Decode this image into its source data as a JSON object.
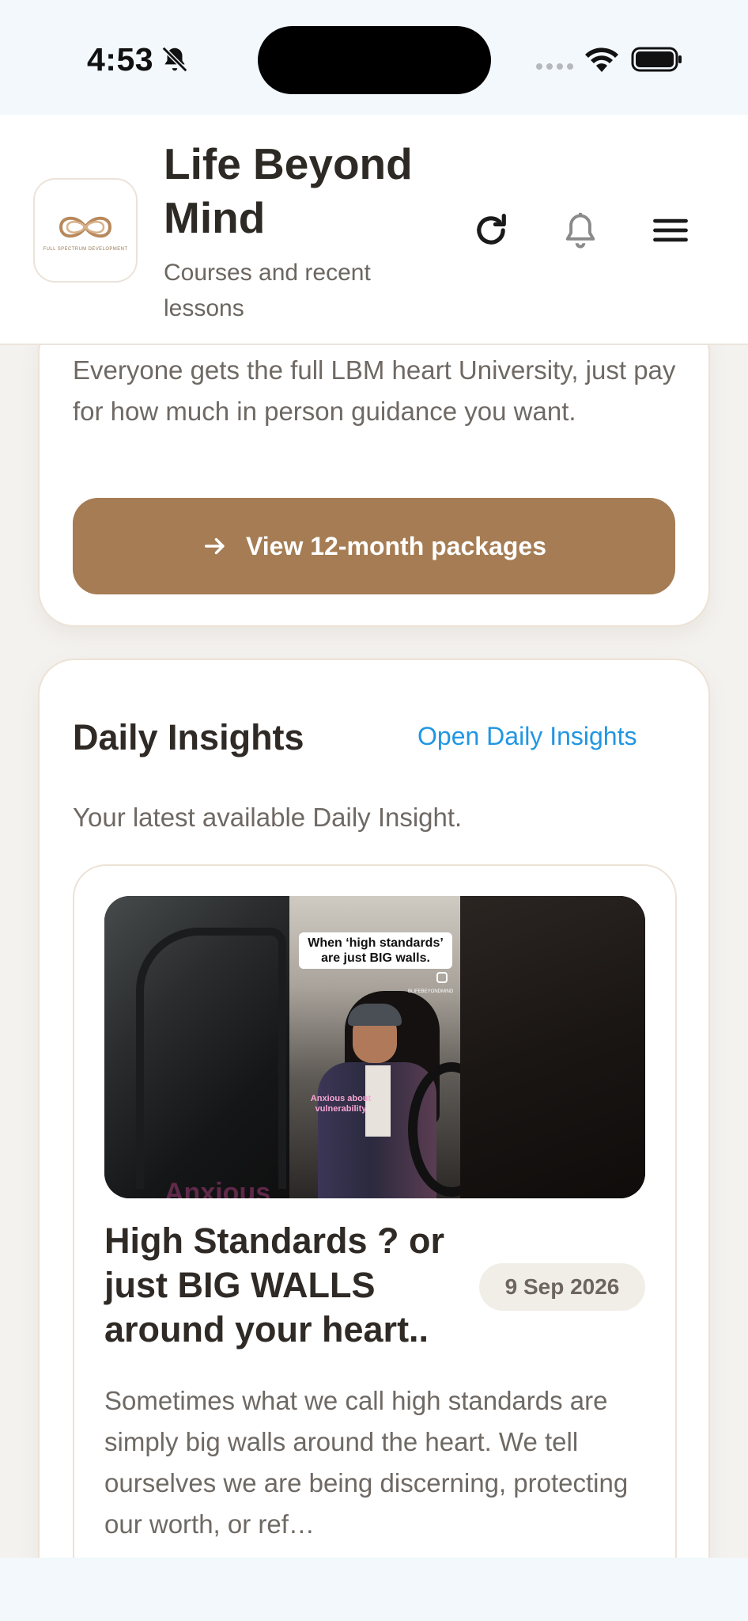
{
  "status_bar": {
    "time": "4:53",
    "icons": [
      "bell-slash-icon",
      "cellular-dots-icon",
      "wifi-icon",
      "battery-icon"
    ]
  },
  "header": {
    "title": "Life Beyond Mind",
    "subtitle": "Courses and recent lessons",
    "logo_caption": "FULL SPECTRUM DEVELOPMENT",
    "icons": [
      "refresh-icon",
      "bell-icon",
      "menu-icon"
    ]
  },
  "packages": {
    "description": "Everyone gets the full LBM heart University, just pay for how much in person guidance you want.",
    "button_label": "View 12-month packages"
  },
  "daily_insights": {
    "title": "Daily Insights",
    "link_label": "Open Daily Insights",
    "subtitle": "Your latest available Daily Insight.",
    "item": {
      "thumbnail_caption": "When ‘high standards’ are just BIG walls.",
      "thumbnail_tag": "Anxious about vulnerability",
      "thumbnail_handle": "BLIFEBEYONDMIND",
      "thumbnail_bottom_text": "Anxious",
      "title": "High Standards ? or just BIG WALLS around your heart..",
      "date": "9 Sep 2026",
      "description": "Sometimes what we call high standards are simply big walls around the heart. We tell ourselves we are being discerning, protecting our worth, or ref…"
    }
  },
  "colors": {
    "accent_brown": "#a57c53",
    "link_blue": "#2196e3",
    "background": "#f4f2ef"
  }
}
